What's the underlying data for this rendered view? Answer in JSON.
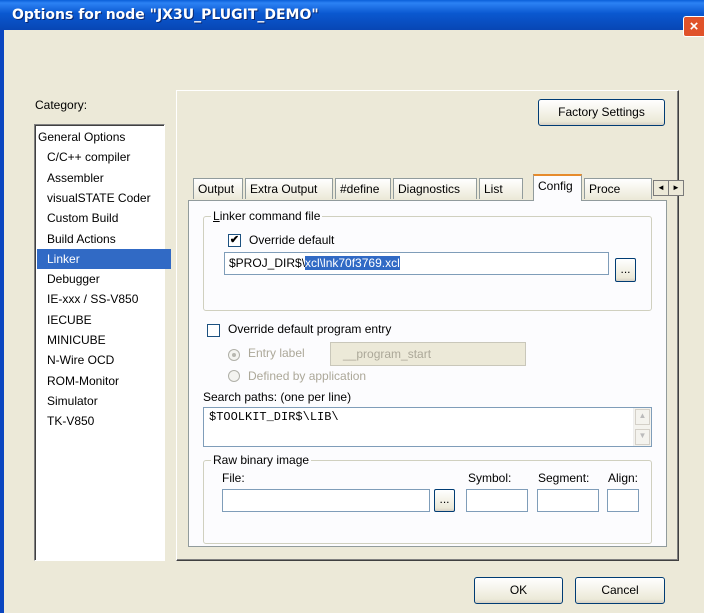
{
  "window": {
    "title": "Options for node \"JX3U_PLUGIT_DEMO\"",
    "close_glyph": "×"
  },
  "category": {
    "label": "Category:",
    "items": [
      {
        "label": "General Options",
        "indent": false
      },
      {
        "label": "C/C++ compiler",
        "indent": true
      },
      {
        "label": "Assembler",
        "indent": true
      },
      {
        "label": "visualSTATE Coder",
        "indent": true
      },
      {
        "label": "Custom Build",
        "indent": true
      },
      {
        "label": "Build Actions",
        "indent": true
      },
      {
        "label": "Linker",
        "indent": true,
        "selected": true
      },
      {
        "label": "Debugger",
        "indent": true
      },
      {
        "label": "IE-xxx / SS-V850",
        "indent": true
      },
      {
        "label": "IECUBE",
        "indent": true
      },
      {
        "label": "MINICUBE",
        "indent": true
      },
      {
        "label": "N-Wire OCD",
        "indent": true
      },
      {
        "label": "ROM-Monitor",
        "indent": true
      },
      {
        "label": "Simulator",
        "indent": true
      },
      {
        "label": "TK-V850",
        "indent": true
      }
    ]
  },
  "factory_settings_label": "Factory Settings",
  "tabs": [
    "Output",
    "Extra Output",
    "#define",
    "Diagnostics",
    "List",
    "Config",
    "Proce"
  ],
  "active_tab": "Config",
  "tab_scroll": {
    "left": "◄",
    "right": "►"
  },
  "linker_cmd": {
    "group_label": "Linker command file",
    "override_default_label": "Override default",
    "override_checked": true,
    "path_prefix": "$PROJ_DIR$\\",
    "path_selected": "xcl\\lnk70f3769.xcl",
    "browse_label": "..."
  },
  "program_entry": {
    "override_label": "Override default program entry",
    "override_checked": false,
    "entry_label_option": "Entry label",
    "entry_label_value": "__program_start",
    "defined_by_app_option": "Defined by application",
    "selected_option": "Entry label"
  },
  "search_paths": {
    "label": "Search paths:  (one per line)",
    "value": "$TOOLKIT_DIR$\\LIB\\"
  },
  "raw_binary": {
    "group_label": "Raw binary image",
    "file_label": "File:",
    "symbol_label": "Symbol:",
    "segment_label": "Segment:",
    "align_label": "Align:",
    "browse_label": "...",
    "file_value": "",
    "symbol_value": "",
    "segment_value": "",
    "align_value": ""
  },
  "buttons": {
    "ok": "OK",
    "cancel": "Cancel"
  }
}
